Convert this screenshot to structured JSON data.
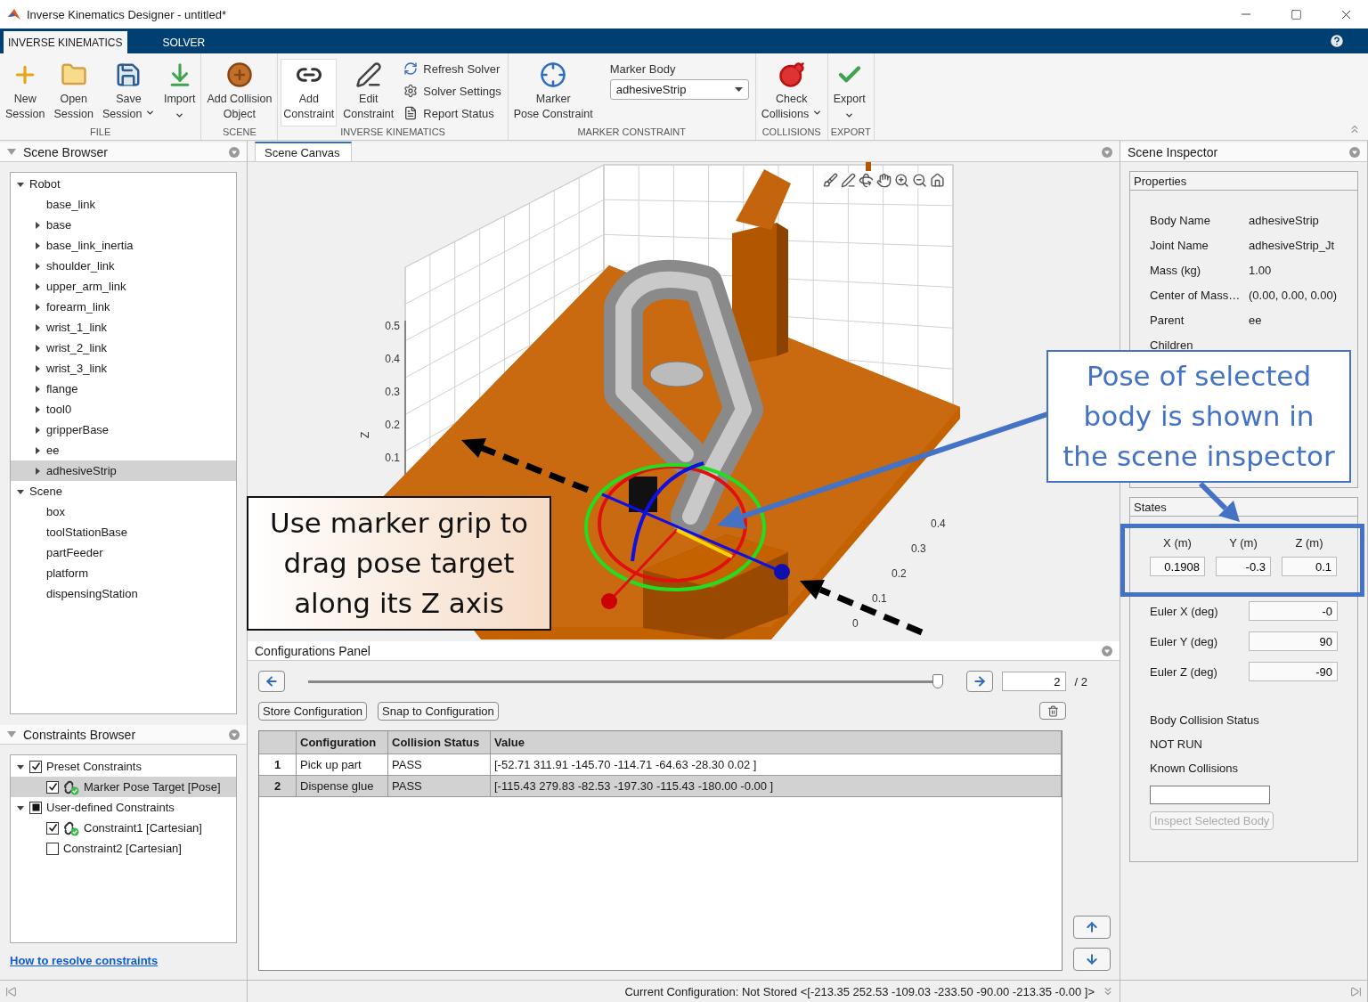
{
  "window": {
    "title": "Inverse Kinematics Designer - untitled*"
  },
  "tabs": [
    {
      "label": "INVERSE KINEMATICS",
      "selected": true
    },
    {
      "label": "SOLVER",
      "selected": false
    }
  ],
  "toolstrip": {
    "groups": [
      {
        "label": "FILE",
        "items": [
          {
            "kind": "large",
            "label": "New\nSession",
            "menu": false,
            "highlighted": false
          },
          {
            "kind": "large",
            "label": "Open\nSession",
            "menu": false,
            "highlighted": false
          },
          {
            "kind": "large",
            "label": "Save\nSession",
            "menu": true,
            "highlighted": false
          },
          {
            "kind": "large",
            "label": "Import",
            "menu": true,
            "highlighted": false
          }
        ]
      },
      {
        "label": "SCENE",
        "items": [
          {
            "kind": "large",
            "label": "Add Collision\nObject",
            "menu": false,
            "highlighted": false
          }
        ]
      },
      {
        "label": "INVERSE KINEMATICS",
        "items": [
          {
            "kind": "large",
            "label": "Add\nConstraint",
            "menu": false,
            "highlighted": true
          },
          {
            "kind": "large",
            "label": "Edit\nConstraint",
            "menu": false,
            "highlighted": false
          },
          {
            "kind": "stack",
            "items": [
              "Refresh Solver",
              "Solver Settings",
              "Report Status"
            ]
          }
        ]
      },
      {
        "label": "MARKER CONSTRAINT",
        "items": [
          {
            "kind": "large",
            "label": "Marker\nPose Constraint",
            "menu": false,
            "highlighted": false
          },
          {
            "kind": "dropdown",
            "label": "Marker Body",
            "value": "adhesiveStrip"
          }
        ]
      },
      {
        "label": "COLLISIONS",
        "items": [
          {
            "kind": "large",
            "label": "Check\nCollisions",
            "menu": true,
            "highlighted": false
          }
        ]
      },
      {
        "label": "EXPORT",
        "items": [
          {
            "kind": "large",
            "label": "Export",
            "menu": true,
            "highlighted": false
          }
        ]
      }
    ]
  },
  "scene_browser": {
    "title": "Scene Browser",
    "tree": [
      {
        "label": "Robot",
        "expanded": true,
        "selected": false,
        "children": [
          {
            "label": "base_link",
            "selected": false
          },
          {
            "label": "base",
            "expanded": false,
            "selected": false
          },
          {
            "label": "base_link_inertia",
            "expanded": false,
            "selected": false
          },
          {
            "label": "shoulder_link",
            "expanded": false,
            "selected": false
          },
          {
            "label": "upper_arm_link",
            "expanded": false,
            "selected": false
          },
          {
            "label": "forearm_link",
            "expanded": false,
            "selected": false
          },
          {
            "label": "wrist_1_link",
            "expanded": false,
            "selected": false
          },
          {
            "label": "wrist_2_link",
            "expanded": false,
            "selected": false
          },
          {
            "label": "wrist_3_link",
            "expanded": false,
            "selected": false
          },
          {
            "label": "flange",
            "expanded": false,
            "selected": false
          },
          {
            "label": "tool0",
            "expanded": false,
            "selected": false
          },
          {
            "label": "gripperBase",
            "expanded": false,
            "selected": false
          },
          {
            "label": "ee",
            "expanded": false,
            "selected": false
          },
          {
            "label": "adhesiveStrip",
            "expanded": false,
            "selected": true
          }
        ]
      },
      {
        "label": "Scene",
        "expanded": true,
        "selected": false,
        "children": [
          {
            "label": "box",
            "selected": false
          },
          {
            "label": "toolStationBase",
            "selected": false
          },
          {
            "label": "partFeeder",
            "selected": false
          },
          {
            "label": "platform",
            "selected": false
          },
          {
            "label": "dispensingStation",
            "selected": false
          }
        ]
      }
    ]
  },
  "constraints_browser": {
    "title": "Constraints Browser",
    "tree": [
      {
        "label": "Preset Constraints",
        "expanded": true,
        "checked": true,
        "indeterminate": false,
        "selected": false,
        "children": [
          {
            "label": "Marker Pose Target [Pose]",
            "checked": true,
            "valid": true,
            "selected": true
          }
        ]
      },
      {
        "label": "User-defined Constraints",
        "expanded": true,
        "checked": false,
        "indeterminate": true,
        "selected": false,
        "children": [
          {
            "label": "Constraint1 [Cartesian]",
            "checked": true,
            "valid": true,
            "selected": false
          },
          {
            "label": "Constraint2 [Cartesian]",
            "checked": false,
            "valid": false,
            "selected": false
          }
        ]
      }
    ],
    "help_link": "How to resolve constraints"
  },
  "canvas": {
    "tab": "Scene Canvas",
    "z_label": "Z",
    "z_ticks": [
      "0.5",
      "0.4",
      "0.3",
      "0.2",
      "0.1"
    ],
    "y_ticks": [
      "0.4",
      "0.3",
      "0.2",
      "0.1",
      "0"
    ]
  },
  "configurations": {
    "title": "Configurations Panel",
    "slider": {
      "level": 1
    },
    "index_field": "2",
    "count": "/ 2",
    "buttons": [
      "Store Configuration",
      "Snap to Configuration"
    ],
    "table": {
      "columns": [
        "Configuration",
        "Collision Status",
        "Value"
      ],
      "rows": [
        {
          "index": "1",
          "cells": [
            "Pick up part",
            "PASS",
            "[-52.71 311.91 -145.70 -114.71 -64.63 -28.30 0.02 ]"
          ],
          "selected": false
        },
        {
          "index": "2",
          "cells": [
            "Dispense glue",
            "PASS",
            "[-115.43 279.83 -82.53 -197.30 -115.43 -180.00 -0.00 ]"
          ],
          "selected": true
        }
      ]
    }
  },
  "inspector": {
    "title": "Scene Inspector",
    "properties": {
      "title": "Properties",
      "rows": [
        {
          "label": "Body Name",
          "value": "adhesiveStrip"
        },
        {
          "label": "Joint Name",
          "value": "adhesiveStrip_Jt"
        },
        {
          "label": "Mass (kg)",
          "value": "1.00"
        },
        {
          "label": "Center of Mass…",
          "value": "(0.00, 0.00, 0.00)"
        },
        {
          "label": "Parent",
          "value": "ee"
        },
        {
          "label": "Children"
        }
      ]
    },
    "states": {
      "title": "States",
      "position": [
        {
          "label": "X (m)",
          "value": "0.1908"
        },
        {
          "label": "Y (m)",
          "value": "-0.3"
        },
        {
          "label": "Z (m)",
          "value": "0.1"
        }
      ],
      "euler": [
        {
          "label": "Euler X (deg)",
          "value": "-0"
        },
        {
          "label": "Euler Y (deg)",
          "value": "90"
        },
        {
          "label": "Euler Z (deg)",
          "value": "-90"
        }
      ],
      "collision_label": "Body Collision Status",
      "collision_status": "NOT RUN",
      "known_label": "Known Collisions",
      "inspect_button": {
        "label": "Inspect Selected Body",
        "disabled": true
      }
    }
  },
  "status_bar": {
    "text": "Current Configuration: Not Stored <[-213.35 252.53 -109.03 -233.50 -90.00 -213.35 -0.00 ]>"
  },
  "annotations": [
    {
      "text": "Use marker grip to drag pose target along its Z axis"
    },
    {
      "text": "Pose of selected body is shown in the scene inspector"
    }
  ]
}
